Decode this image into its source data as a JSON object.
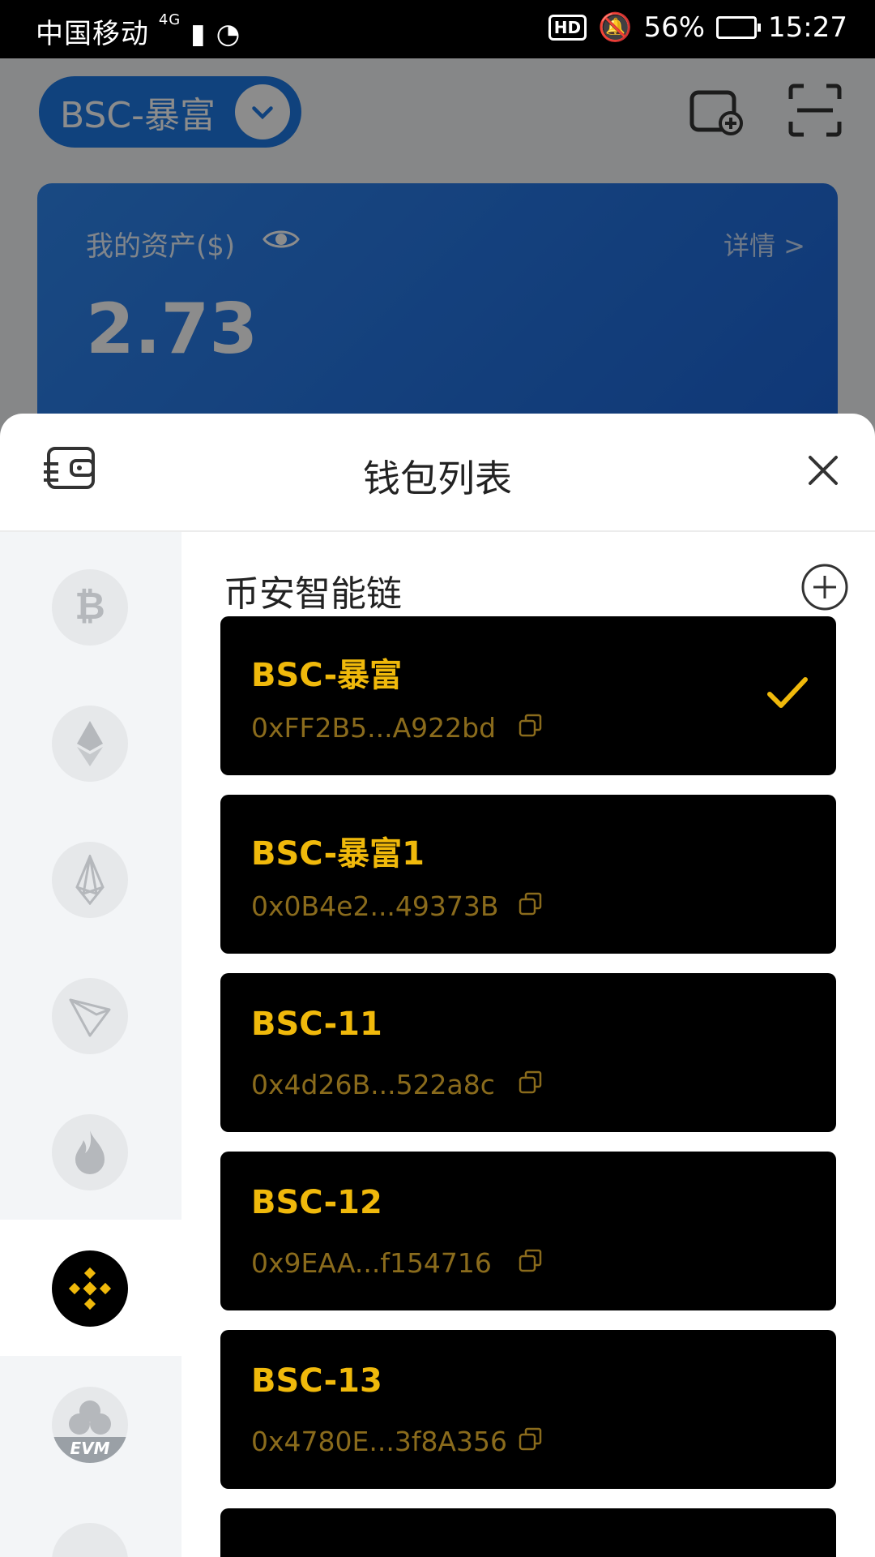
{
  "status_bar": {
    "carrier": "中国移动",
    "network": "4G",
    "hd": "HD",
    "battery": "56%",
    "time": "15:27"
  },
  "header": {
    "network_name": "BSC-暴富"
  },
  "asset_card": {
    "label": "我的资产($)",
    "value": "2.73",
    "detail_link": "详情 >"
  },
  "sheet": {
    "title": "钱包列表",
    "section_title": "币安智能链"
  },
  "chains": [
    {
      "name": "bitcoin",
      "selected": false
    },
    {
      "name": "ethereum",
      "selected": false
    },
    {
      "name": "eos",
      "selected": false
    },
    {
      "name": "tron",
      "selected": false
    },
    {
      "name": "fire",
      "selected": false
    },
    {
      "name": "binance-smart-chain",
      "selected": true
    },
    {
      "name": "evm",
      "label": "EVM",
      "selected": false
    },
    {
      "name": "more",
      "selected": false
    }
  ],
  "wallets": [
    {
      "name": "BSC-暴富",
      "address": "0xFF2B5...A922bd",
      "selected": true
    },
    {
      "name": "BSC-暴富1",
      "address": "0x0B4e2...49373B",
      "selected": false
    },
    {
      "name": "BSC-11",
      "address": "0x4d26B...522a8c",
      "selected": false
    },
    {
      "name": "BSC-12",
      "address": "0x9EAA...f154716",
      "selected": false
    },
    {
      "name": "BSC-13",
      "address": "0x4780E...3f8A356",
      "selected": false
    }
  ],
  "colors": {
    "accent_blue": "#1e79e3",
    "gold": "#f0b90b",
    "card_bg": "#000000"
  }
}
